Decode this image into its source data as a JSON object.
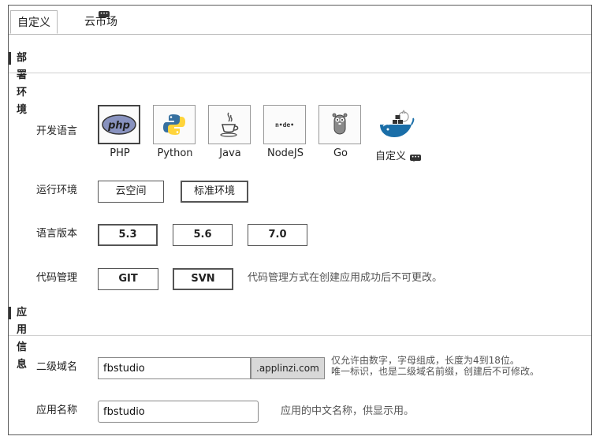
{
  "tabs": [
    {
      "label": "自定义",
      "active": true
    },
    {
      "label": "云市场",
      "active": false
    }
  ],
  "sections": {
    "deploy": "部署环境",
    "app_info": "应用信息"
  },
  "dev_language": {
    "label": "开发语言",
    "options": [
      {
        "name": "PHP",
        "icon": "php-logo-icon",
        "selected": true
      },
      {
        "name": "Python",
        "icon": "python-logo-icon"
      },
      {
        "name": "Java",
        "icon": "java-logo-icon"
      },
      {
        "name": "NodeJS",
        "icon": "nodejs-logo-icon"
      },
      {
        "name": "Go",
        "icon": "go-gopher-icon"
      },
      {
        "name": "自定义",
        "icon": "docker-whale-icon"
      }
    ]
  },
  "runtime": {
    "label": "运行环境",
    "options": [
      "云空间",
      "标准环境"
    ],
    "selected": "标准环境"
  },
  "lang_version": {
    "label": "语言版本",
    "options": [
      "5.3",
      "5.6",
      "7.0"
    ]
  },
  "code_mgmt": {
    "label": "代码管理",
    "options": [
      "GIT",
      "SVN"
    ],
    "hint": "代码管理方式在创建应用成功后不可更改。"
  },
  "subdomain": {
    "label": "二级域名",
    "value": "fbstudio",
    "suffix": ".applinzi.com",
    "hint_line1": "仅允许由数字，字母组成，长度为4到18位。",
    "hint_line2": "唯一标识，也是二级域名前缀，创建后不可修改。"
  },
  "app_name": {
    "label": "应用名称",
    "value": "fbstudio",
    "hint": "应用的中文名称，供显示用。"
  },
  "colors": {
    "border": "#555555",
    "badge": "#333333",
    "suffix_bg": "#d8d8d8",
    "php_purple": "#8892bf",
    "python_blue": "#3670a0",
    "python_yellow": "#ffd43b",
    "docker_blue": "#1a6ea8"
  }
}
